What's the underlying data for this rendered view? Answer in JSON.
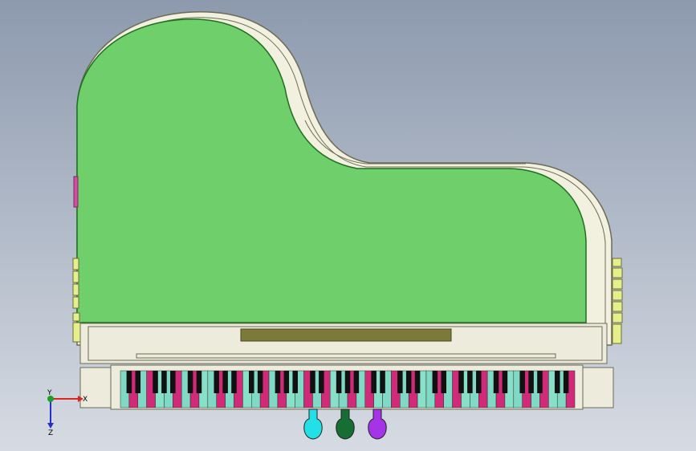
{
  "viewport": {
    "background_top": "#8d9aae",
    "background_bottom": "#d6dbe3"
  },
  "model": {
    "lid_color": "#6fcf6a",
    "lid_edge_color": "#1f6e23",
    "rim_color": "#f2f0df",
    "rim_edge_color": "#6b6b55",
    "cheek_color": "#ecebdc",
    "music_desk_color": "#7b7a3a",
    "key_black_color": "#111111",
    "hinge_color": "#e6f08a",
    "side_tab_color": "#d04fa0",
    "key_colors": [
      "#7fd9c4",
      "#d02a78",
      "#7fd9c4",
      "#d02a78",
      "#88e0c8"
    ],
    "key_count": 52,
    "pedals": [
      {
        "name": "pedal-left",
        "color": "#23e0e6"
      },
      {
        "name": "pedal-middle",
        "color": "#166e35"
      },
      {
        "name": "pedal-right",
        "color": "#a533e8"
      }
    ]
  },
  "triad": {
    "x_label": "X",
    "y_label": "Y",
    "z_label": "Z",
    "x_color": "#e0231f",
    "y_color": "#1f9e2a",
    "z_color": "#2230c9"
  }
}
